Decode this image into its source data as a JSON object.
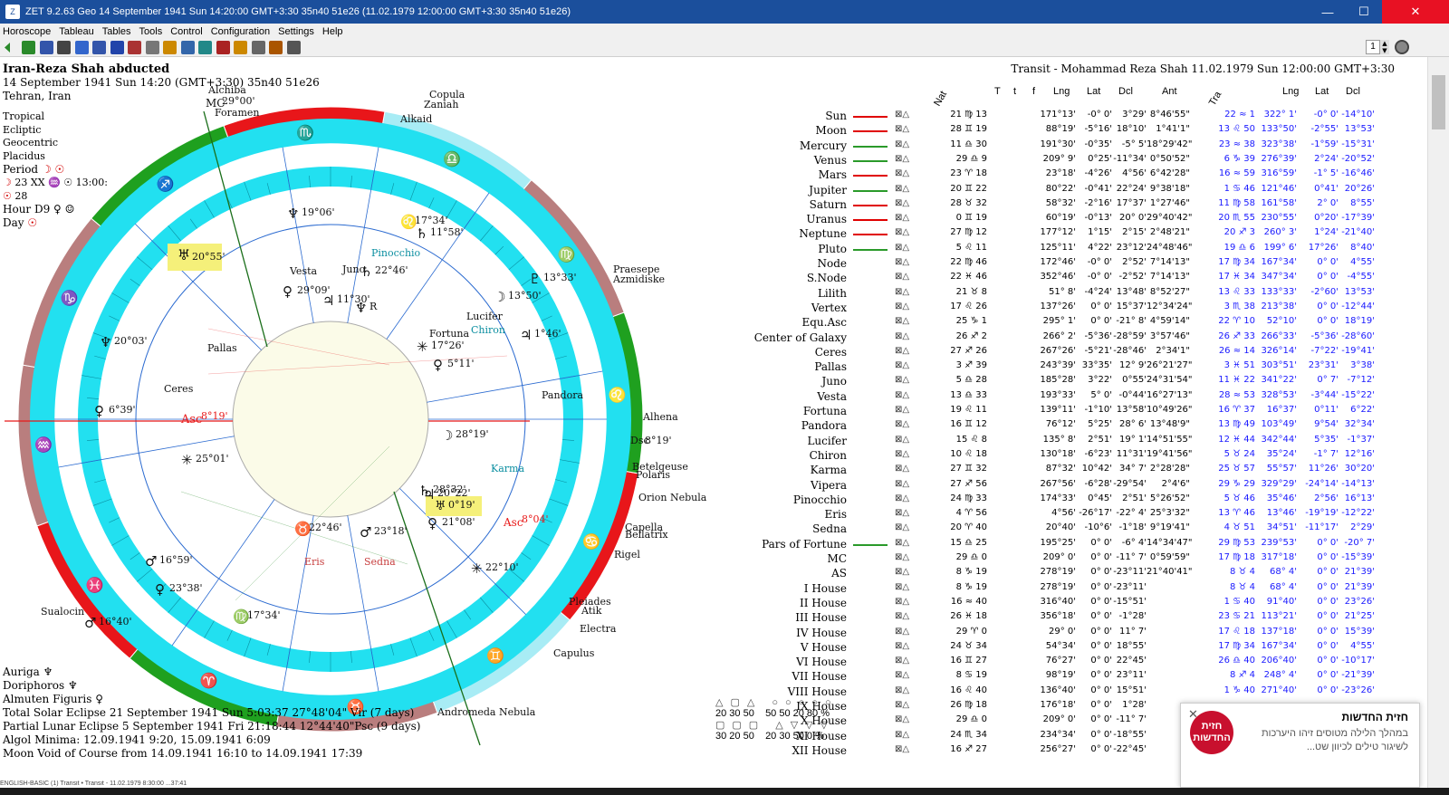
{
  "window": {
    "title": "ZET 9.2.63 Geo   14 September 1941  Sun  14:20:00 GMT+3:30 35n40 51e26   (11.02.1979  12:00:00 GMT+3:30 35n40 51e26)",
    "icon": "zet-app-icon",
    "controls": {
      "minimize": "—",
      "maximize": "☐",
      "close": "✕"
    }
  },
  "menu": [
    "Horoscope",
    "Tableau",
    "Tables",
    "Tools",
    "Control",
    "Configuration",
    "Settings",
    "Help"
  ],
  "toolbar": {
    "page_number": "1",
    "button_colors": [
      "#2a8a2a",
      "#3355aa",
      "#444444",
      "#3366cc",
      "#3355aa",
      "#2244aa",
      "#aa3333",
      "#777777",
      "#cc8800",
      "#3366aa",
      "#228888",
      "#aa2222",
      "#cc8800",
      "#666666",
      "#aa5500",
      "#555555"
    ]
  },
  "chart": {
    "name": "Iran-Reza Shah abducted",
    "datetime": "14 September 1941  Sun  14:20 (GMT+3:30) 35n40  51e26",
    "place": "Tehran, Iran",
    "settings": [
      "Tropical",
      "Ecliptic",
      "Geocentric",
      "Placidus"
    ],
    "period_label": "Period",
    "period_line1": "23 XX",
    "period_time": "13:00:",
    "period_line2": "28",
    "hour_label": "Hour D9",
    "day_label": "Day"
  },
  "transit_header": "Transit - Mohammad Reza Shah 11.02.1979  Sun 12:00:00 GMT+3:30",
  "columns": {
    "nat": "Nat",
    "t1": "T",
    "t2": "t",
    "f": "f",
    "lng": "Lng",
    "lat": "Lat",
    "dcl": "Dcl",
    "ant": "Ant",
    "tra": "Tra",
    "tlng": "Lng",
    "tlat": "Lat",
    "tdcl": "Dcl"
  },
  "rows": [
    {
      "name": "Sun",
      "bar": "#e00000",
      "pos": "21 ♍ 13",
      "lng": "171°13'",
      "lat": "-0° 0'",
      "dcl": "3°29'",
      "ant": "8°46'55\"",
      "tpos": "22 ≈ 1",
      "tlng": "322° 1'",
      "tlat": "-0° 0'",
      "tdcl": "-14°10'"
    },
    {
      "name": "Moon",
      "bar": "#e00000",
      "pos": "28 ♊ 19",
      "lng": "88°19'",
      "lat": "-5°16'",
      "dcl": "18°10'",
      "ant": "1°41'1\"",
      "tpos": "13 ♌ 50",
      "tlng": "133°50'",
      "tlat": "-2°55'",
      "tdcl": "13°53'"
    },
    {
      "name": "Mercury",
      "bar": "#2a9a2a",
      "pos": "11 ♎ 30",
      "lng": "191°30'",
      "lat": "-0°35'",
      "dcl": "-5° 5'",
      "ant": "18°29'42\"",
      "tpos": "23 ≈ 38",
      "tlng": "323°38'",
      "tlat": "-1°59'",
      "tdcl": "-15°31'"
    },
    {
      "name": "Venus",
      "bar": "#2a9a2a",
      "pos": "29 ♎ 9",
      "lng": "209° 9'",
      "lat": "0°25'",
      "dcl": "-11°34'",
      "ant": "0°50'52\"",
      "tpos": "6 ♑ 39",
      "tlng": "276°39'",
      "tlat": "2°24'",
      "tdcl": "-20°52'"
    },
    {
      "name": "Mars",
      "bar": "#e00000",
      "pos": "23 ♈ 18",
      "lng": "23°18'",
      "lat": "-4°26'",
      "dcl": "4°56'",
      "ant": "6°42'28\"",
      "tpos": "16 ≈ 59",
      "tlng": "316°59'",
      "tlat": "-1° 5'",
      "tdcl": "-16°46'"
    },
    {
      "name": "Jupiter",
      "bar": "#2a9a2a",
      "pos": "20 ♊ 22",
      "lng": "80°22'",
      "lat": "-0°41'",
      "dcl": "22°24'",
      "ant": "9°38'18\"",
      "tpos": "1 ♋ 46",
      "tlng": "121°46'",
      "tlat": "0°41'",
      "tdcl": "20°26'"
    },
    {
      "name": "Saturn",
      "bar": "#e00000",
      "pos": "28 ♉ 32",
      "lng": "58°32'",
      "lat": "-2°16'",
      "dcl": "17°37'",
      "ant": "1°27'46\"",
      "tpos": "11 ♍ 58",
      "tlng": "161°58'",
      "tlat": "2° 0'",
      "tdcl": "8°55'"
    },
    {
      "name": "Uranus",
      "bar": "#e00000",
      "pos": "0 ♊ 19",
      "lng": "60°19'",
      "lat": "-0°13'",
      "dcl": "20° 0'",
      "ant": "29°40'42\"",
      "tpos": "20 ♏ 55",
      "tlng": "230°55'",
      "tlat": "0°20'",
      "tdcl": "-17°39'"
    },
    {
      "name": "Neptune",
      "bar": "#e00000",
      "pos": "27 ♍ 12",
      "lng": "177°12'",
      "lat": "1°15'",
      "dcl": "2°15'",
      "ant": "2°48'21\"",
      "tpos": "20 ♐ 3",
      "tlng": "260° 3'",
      "tlat": "1°24'",
      "tdcl": "-21°40'"
    },
    {
      "name": "Pluto",
      "bar": "#2a9a2a",
      "pos": "5 ♌ 11",
      "lng": "125°11'",
      "lat": "4°22'",
      "dcl": "23°12'",
      "ant": "24°48'46\"",
      "tpos": "19 ♎ 6",
      "tlng": "199° 6'",
      "tlat": "17°26'",
      "tdcl": "8°40'"
    },
    {
      "name": "Node",
      "bar": "",
      "pos": "22 ♍ 46",
      "lng": "172°46'",
      "lat": "-0° 0'",
      "dcl": "2°52'",
      "ant": "7°14'13\"",
      "tpos": "17 ♍ 34",
      "tlng": "167°34'",
      "tlat": "0° 0'",
      "tdcl": "4°55'"
    },
    {
      "name": "S.Node",
      "bar": "",
      "pos": "22 ♓ 46",
      "lng": "352°46'",
      "lat": "-0° 0'",
      "dcl": "-2°52'",
      "ant": "7°14'13\"",
      "tpos": "17 ♓ 34",
      "tlng": "347°34'",
      "tlat": "0° 0'",
      "tdcl": "-4°55'"
    },
    {
      "name": "Lilith",
      "bar": "",
      "pos": "21 ♉ 8",
      "lng": "51° 8'",
      "lat": "-4°24'",
      "dcl": "13°48'",
      "ant": "8°52'27\"",
      "tpos": "13 ♌ 33",
      "tlng": "133°33'",
      "tlat": "-2°60'",
      "tdcl": "13°53'"
    },
    {
      "name": "Vertex",
      "bar": "",
      "pos": "17 ♌ 26",
      "lng": "137°26'",
      "lat": "0° 0'",
      "dcl": "15°37'",
      "ant": "12°34'24\"",
      "tpos": "3 ♏ 38",
      "tlng": "213°38'",
      "tlat": "0° 0'",
      "tdcl": "-12°44'"
    },
    {
      "name": "Equ.Asc",
      "bar": "",
      "pos": "25 ♑ 1",
      "lng": "295° 1'",
      "lat": "0° 0'",
      "dcl": "-21° 8'",
      "ant": "4°59'14\"",
      "tpos": "22 ♈ 10",
      "tlng": "52°10'",
      "tlat": "0° 0'",
      "tdcl": "18°19'"
    },
    {
      "name": "Center of Galaxy",
      "bar": "",
      "pos": "26 ♐ 2",
      "lng": "266° 2'",
      "lat": "-5°36'",
      "dcl": "-28°59'",
      "ant": "3°57'46\"",
      "tpos": "26 ♐ 33",
      "tlng": "266°33'",
      "tlat": "-5°36'",
      "tdcl": "-28°60'"
    },
    {
      "name": "Ceres",
      "bar": "",
      "pos": "27 ♐ 26",
      "lng": "267°26'",
      "lat": "-5°21'",
      "dcl": "-28°46'",
      "ant": "2°34'1\"",
      "tpos": "26 ≈ 14",
      "tlng": "326°14'",
      "tlat": "-7°22'",
      "tdcl": "-19°41'"
    },
    {
      "name": "Pallas",
      "bar": "",
      "pos": "3 ♐ 39",
      "lng": "243°39'",
      "lat": "33°35'",
      "dcl": "12° 9'",
      "ant": "26°21'27\"",
      "tpos": "3 ♓ 51",
      "tlng": "303°51'",
      "tlat": "23°31'",
      "tdcl": "3°38'"
    },
    {
      "name": "Juno",
      "bar": "",
      "pos": "5 ♎ 28",
      "lng": "185°28'",
      "lat": "3°22'",
      "dcl": "0°55'",
      "ant": "24°31'54\"",
      "tpos": "11 ♓ 22",
      "tlng": "341°22'",
      "tlat": "0° 7'",
      "tdcl": "-7°12'"
    },
    {
      "name": "Vesta",
      "bar": "",
      "pos": "13 ♎ 33",
      "lng": "193°33'",
      "lat": "5° 0'",
      "dcl": "-0°44'",
      "ant": "16°27'13\"",
      "tpos": "28 ≈ 53",
      "tlng": "328°53'",
      "tlat": "-3°44'",
      "tdcl": "-15°22'"
    },
    {
      "name": "Fortuna",
      "bar": "",
      "pos": "19 ♌ 11",
      "lng": "139°11'",
      "lat": "-1°10'",
      "dcl": "13°58'",
      "ant": "10°49'26\"",
      "tpos": "16 ♈ 37",
      "tlng": "16°37'",
      "tlat": "0°11'",
      "tdcl": "6°22'"
    },
    {
      "name": "Pandora",
      "bar": "",
      "pos": "16 ♊ 12",
      "lng": "76°12'",
      "lat": "5°25'",
      "dcl": "28° 6'",
      "ant": "13°48'9\"",
      "tpos": "13 ♍ 49",
      "tlng": "103°49'",
      "tlat": "9°54'",
      "tdcl": "32°34'"
    },
    {
      "name": "Lucifer",
      "bar": "",
      "pos": "15 ♌ 8",
      "lng": "135° 8'",
      "lat": "2°51'",
      "dcl": "19° 1'",
      "ant": "14°51'55\"",
      "tpos": "12 ♓ 44",
      "tlng": "342°44'",
      "tlat": "5°35'",
      "tdcl": "-1°37'"
    },
    {
      "name": "Chiron",
      "bar": "",
      "pos": "10 ♌ 18",
      "lng": "130°18'",
      "lat": "-6°23'",
      "dcl": "11°31'",
      "ant": "19°41'56\"",
      "tpos": "5 ♉ 24",
      "tlng": "35°24'",
      "tlat": "-1° 7'",
      "tdcl": "12°16'"
    },
    {
      "name": "Karma",
      "bar": "",
      "pos": "27 ♊ 32",
      "lng": "87°32'",
      "lat": "10°42'",
      "dcl": "34° 7'",
      "ant": "2°28'28\"",
      "tpos": "25 ♉ 57",
      "tlng": "55°57'",
      "tlat": "11°26'",
      "tdcl": "30°20'"
    },
    {
      "name": "Vipera",
      "bar": "",
      "pos": "27 ♐ 56",
      "lng": "267°56'",
      "lat": "-6°28'",
      "dcl": "-29°54'",
      "ant": "2°4'6\"",
      "tpos": "29 ♑ 29",
      "tlng": "329°29'",
      "tlat": "-24°14'",
      "tdcl": "-14°13'"
    },
    {
      "name": "Pinocchio",
      "bar": "",
      "pos": "24 ♍ 33",
      "lng": "174°33'",
      "lat": "0°45'",
      "dcl": "2°51'",
      "ant": "5°26'52\"",
      "tpos": "5 ♉ 46",
      "tlng": "35°46'",
      "tlat": "2°56'",
      "tdcl": "16°13'"
    },
    {
      "name": "Eris",
      "bar": "",
      "pos": "4 ♈ 56",
      "lng": "4°56'",
      "lat": "-26°17'",
      "dcl": "-22° 4'",
      "ant": "25°3'32\"",
      "tpos": "13 ♈ 46",
      "tlng": "13°46'",
      "tlat": "-19°19'",
      "tdcl": "-12°22'"
    },
    {
      "name": "Sedna",
      "bar": "",
      "pos": "20 ♈ 40",
      "lng": "20°40'",
      "lat": "-10°6'",
      "dcl": "-1°18'",
      "ant": "9°19'41\"",
      "tpos": "4 ♉ 51",
      "tlng": "34°51'",
      "tlat": "-11°17'",
      "tdcl": "2°29'"
    },
    {
      "name": "Pars of Fortune",
      "bar": "#2a9a2a",
      "pos": "15 ♎ 25",
      "lng": "195°25'",
      "lat": "0° 0'",
      "dcl": "-6° 4'",
      "ant": "14°34'47\"",
      "tpos": "29 ♍ 53",
      "tlng": "239°53'",
      "tlat": "0° 0'",
      "tdcl": "-20° 7'"
    },
    {
      "name": "MC",
      "bar": "",
      "pos": "29 ♎ 0",
      "lng": "209° 0'",
      "lat": "0° 0'",
      "dcl": "-11° 7'",
      "ant": "0°59'59\"",
      "tpos": "17 ♍ 18",
      "tlng": "317°18'",
      "tlat": "0° 0'",
      "tdcl": "-15°39'"
    },
    {
      "name": "AS",
      "bar": "",
      "pos": "8 ♑ 19",
      "lng": "278°19'",
      "lat": "0° 0'",
      "dcl": "-23°11'",
      "ant": "21°40'41\"",
      "tpos": "8 ♉ 4",
      "tlng": "68° 4'",
      "tlat": "0° 0'",
      "tdcl": "21°39'"
    },
    {
      "name": "I House",
      "bar": "",
      "pos": "8 ♑ 19",
      "lng": "278°19'",
      "lat": "0° 0'",
      "dcl": "-23°11'",
      "ant": "",
      "tpos": "8 ♉ 4",
      "tlng": "68° 4'",
      "tlat": "0° 0'",
      "tdcl": "21°39'"
    },
    {
      "name": "II House",
      "bar": "",
      "pos": "16 ≈ 40",
      "lng": "316°40'",
      "lat": "0° 0'",
      "dcl": "-15°51'",
      "ant": "",
      "tpos": "1 ♋ 40",
      "tlng": "91°40'",
      "tlat": "0° 0'",
      "tdcl": "23°26'"
    },
    {
      "name": "III House",
      "bar": "",
      "pos": "26 ♓ 18",
      "lng": "356°18'",
      "lat": "0° 0'",
      "dcl": "-1°28'",
      "ant": "",
      "tpos": "23 ♋ 21",
      "tlng": "113°21'",
      "tlat": "0° 0'",
      "tdcl": "21°25'"
    },
    {
      "name": "IV House",
      "bar": "",
      "pos": "29 ♈ 0",
      "lng": "29° 0'",
      "lat": "0° 0'",
      "dcl": "11° 7'",
      "ant": "",
      "tpos": "17 ♌ 18",
      "tlng": "137°18'",
      "tlat": "0° 0'",
      "tdcl": "15°39'"
    },
    {
      "name": "V House",
      "bar": "",
      "pos": "24 ♉ 34",
      "lng": "54°34'",
      "lat": "0° 0'",
      "dcl": "18°55'",
      "ant": "",
      "tpos": "17 ♍ 34",
      "tlng": "167°34'",
      "tlat": "0° 0'",
      "tdcl": "4°55'"
    },
    {
      "name": "VI House",
      "bar": "",
      "pos": "16 ♊ 27",
      "lng": "76°27'",
      "lat": "0° 0'",
      "dcl": "22°45'",
      "ant": "",
      "tpos": "26 ♎ 40",
      "tlng": "206°40'",
      "tlat": "0° 0'",
      "tdcl": "-10°17'"
    },
    {
      "name": "VII House",
      "bar": "",
      "pos": "8 ♋ 19",
      "lng": "98°19'",
      "lat": "0° 0'",
      "dcl": "23°11'",
      "ant": "",
      "tpos": "8 ♐ 4",
      "tlng": "248° 4'",
      "tlat": "0° 0'",
      "tdcl": "-21°39'"
    },
    {
      "name": "VIII House",
      "bar": "",
      "pos": "16 ♌ 40",
      "lng": "136°40'",
      "lat": "0° 0'",
      "dcl": "15°51'",
      "ant": "",
      "tpos": "1 ♑ 40",
      "tlng": "271°40'",
      "tlat": "0° 0'",
      "tdcl": "-23°26'"
    },
    {
      "name": "IX House",
      "bar": "",
      "pos": "26 ♍ 18",
      "lng": "176°18'",
      "lat": "0° 0'",
      "dcl": "1°28'",
      "ant": "",
      "tpos": "",
      "tlng": "",
      "tlat": "",
      "tdcl": ""
    },
    {
      "name": "X House",
      "bar": "",
      "pos": "29 ♎ 0",
      "lng": "209° 0'",
      "lat": "0° 0'",
      "dcl": "-11° 7'",
      "ant": "",
      "tpos": "",
      "tlng": "",
      "tlat": "",
      "tdcl": ""
    },
    {
      "name": "XI House",
      "bar": "",
      "pos": "24 ♏ 34",
      "lng": "234°34'",
      "lat": "0° 0'",
      "dcl": "-18°55'",
      "ant": "",
      "tpos": "",
      "tlng": "",
      "tlat": "",
      "tdcl": ""
    },
    {
      "name": "XII House",
      "bar": "",
      "pos": "16 ♐ 27",
      "lng": "256°27'",
      "lat": "0° 0'",
      "dcl": "-22°45'",
      "ant": "",
      "tpos": "",
      "tlng": "",
      "tlat": "",
      "tdcl": ""
    }
  ],
  "bottom_info": [
    "Auriga  ♆",
    "Doriphoros  ♆",
    "Almuten Figuris  ♀",
    "Total Solar Eclipse 21 September 1941 Sun  5:03:37 27°48'04\" Vir (7 days)",
    "Partial Lunar Eclipse 5 September 1941 Fri 21:18:44 12°44'40\"Psc (9 days)",
    "Algol Minima: 12.09.1941  9:20,  15.09.1941  6:09",
    "Moon Void of Course from 14.09.1941 16:10 to 14.09.1941 17:39"
  ],
  "legend": {
    "row1_a": "20  30  50",
    "row1_b": "50  50  20  80 %",
    "row2_a": "30  20  50",
    "row2_b": "20  30  50    0 %"
  },
  "zodiac_labels": [
    "♒",
    "♓",
    "♈",
    "♉",
    "♊",
    "♋",
    "♌",
    "♍",
    "♎",
    "♏",
    "♐",
    "♑"
  ],
  "wheel_labels": {
    "asc": "Asc",
    "asc_deg": "8°19'",
    "dsc": "Dsc",
    "dsc_deg": "8°19'",
    "mc": "MC",
    "mc_deg": "29°00'",
    "t_asc": "Asc",
    "t_asc_deg": "8°04'",
    "uranus_hl": "20°55'",
    "pluto_hl": "0°19'",
    "labels": [
      "Pinocchio",
      "Vesta",
      "Juno",
      "Lucifer",
      "Chiron",
      "Pallas",
      "Ceres",
      "Pandora",
      "Fortuna",
      "Karma",
      "Eris",
      "Sedna",
      "Alchiba",
      "Copula",
      "Alkaid",
      "Praesepe",
      "Azmidiske",
      "Alhena",
      "Betelgeuse",
      "Polaris",
      "Orion Nebula",
      "Capella",
      "Bellatrix",
      "Rigel",
      "Pleiades",
      "Atik",
      "Electra",
      "Capulus",
      "Andromeda Nebula",
      "Sualocin",
      "Foramen",
      "Zaniah"
    ]
  },
  "notification": {
    "title": "חזית החדשות",
    "badge": "חזית החדשות",
    "body": "במהלך הלילה מטוסים זיהו היערכות לשיגור טילים לכיוון שט...",
    "close": "✕"
  },
  "statusbar": "ENGLISH-BASIC (1) Transit     • Transit - 11.02.1979  8:30:00 ...37:41"
}
